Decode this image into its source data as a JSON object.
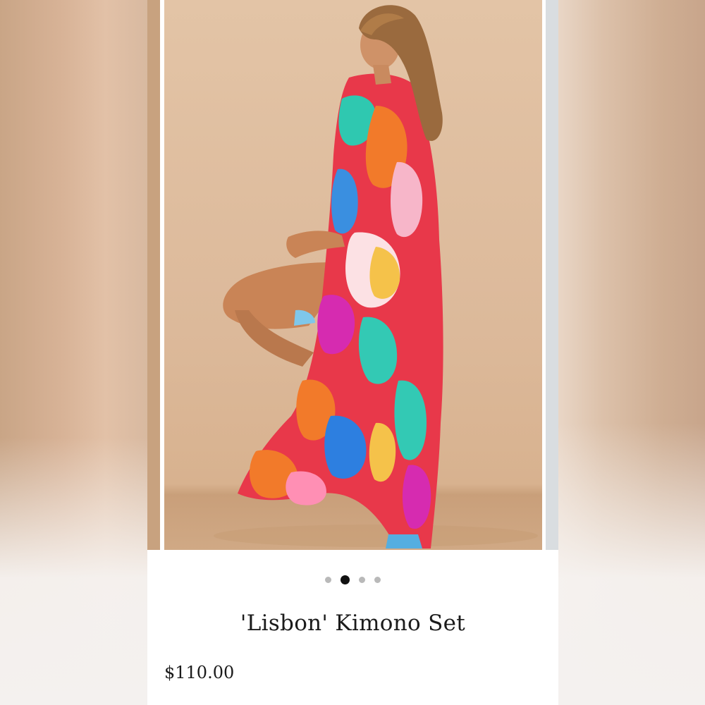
{
  "product": {
    "title": "'Lisbon' Kimono Set",
    "price": "$110.00"
  },
  "gallery": {
    "image_count": 4,
    "active_index": 1,
    "image_subject": "model-in-multicolor-kimono"
  },
  "colors": {
    "backdrop_tan": "#dcb99a",
    "dot_active": "#111111",
    "dot_inactive": "#b9b9b9"
  }
}
